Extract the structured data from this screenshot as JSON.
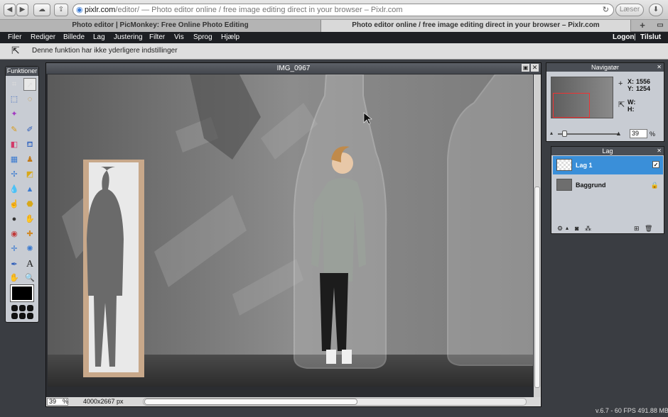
{
  "browser": {
    "url_host": "pixlr.com",
    "url_rest": "/editor/ — Photo editor online / free image editing direct in your browser – Pixlr.com",
    "reader_label": "Læser",
    "tabs": [
      {
        "title": "Photo editor | PicMonkey: Free Online Photo Editing",
        "active": false
      },
      {
        "title": "Photo editor online / free image editing direct in your browser – Pixlr.com",
        "active": true
      }
    ]
  },
  "menubar": {
    "items": [
      "Filer",
      "Rediger",
      "Billede",
      "Lag",
      "Justering",
      "Filter",
      "Vis",
      "Sprog",
      "Hjælp"
    ],
    "logon": "Logon",
    "separator": "|",
    "logout": "Tilslut"
  },
  "options": {
    "message": "Denne funktion har ikke yderligere indstillinger"
  },
  "toolbox": {
    "title": "Funktioner"
  },
  "canvas": {
    "title": "IMG_0967",
    "zoom": "39",
    "zoom_unit": "%",
    "dimensions": "4000x2667 px"
  },
  "navigator": {
    "title": "Navigatør",
    "x_label": "X:",
    "x_value": "1556",
    "y_label": "Y:",
    "y_value": "1254",
    "w_label": "W:",
    "h_label": "H:",
    "zoom": "39",
    "zoom_unit": "%"
  },
  "layers": {
    "title": "Lag",
    "items": [
      {
        "name": "Lag 1",
        "selected": true
      },
      {
        "name": "Baggrund",
        "selected": false
      }
    ]
  },
  "status": {
    "version": "v.6.7 - 60 FPS 491.88 MB"
  },
  "colors": {
    "accent": "#3a8fd9",
    "menubar": "#1d1f23",
    "panel": "#c8ccd3"
  }
}
